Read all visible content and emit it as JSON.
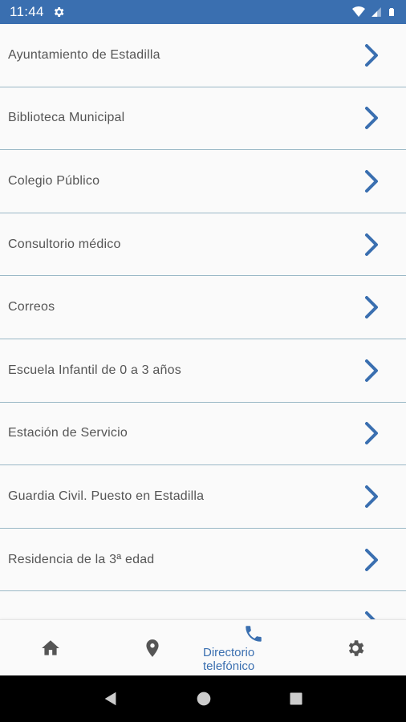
{
  "status_bar": {
    "time": "11:44",
    "background": "#3a6fb0"
  },
  "list": {
    "items": [
      {
        "label": "Ayuntamiento de Estadilla"
      },
      {
        "label": "Biblioteca Municipal"
      },
      {
        "label": "Colegio Público"
      },
      {
        "label": "Consultorio médico"
      },
      {
        "label": "Correos"
      },
      {
        "label": "Escuela Infantil de 0 a 3 años"
      },
      {
        "label": "Estación de Servicio"
      },
      {
        "label": "Guardia Civil. Puesto en Estadilla"
      },
      {
        "label": "Residencia de la 3ª edad"
      },
      {
        "label": ""
      }
    ],
    "chevron_color": "#3a6fb0",
    "divider_color": "#9ab8c6"
  },
  "bottom_nav": {
    "items": [
      {
        "icon": "home-icon",
        "label": ""
      },
      {
        "icon": "location-pin-icon",
        "label": ""
      },
      {
        "icon": "phone-icon",
        "label": "Directorio telefónico",
        "active": true
      },
      {
        "icon": "settings-gear-icon",
        "label": ""
      }
    ],
    "active_color": "#3a6fb0",
    "inactive_color": "#555555"
  },
  "system_nav": {
    "buttons": [
      "back-icon",
      "home-circle-icon",
      "recents-square-icon"
    ]
  }
}
